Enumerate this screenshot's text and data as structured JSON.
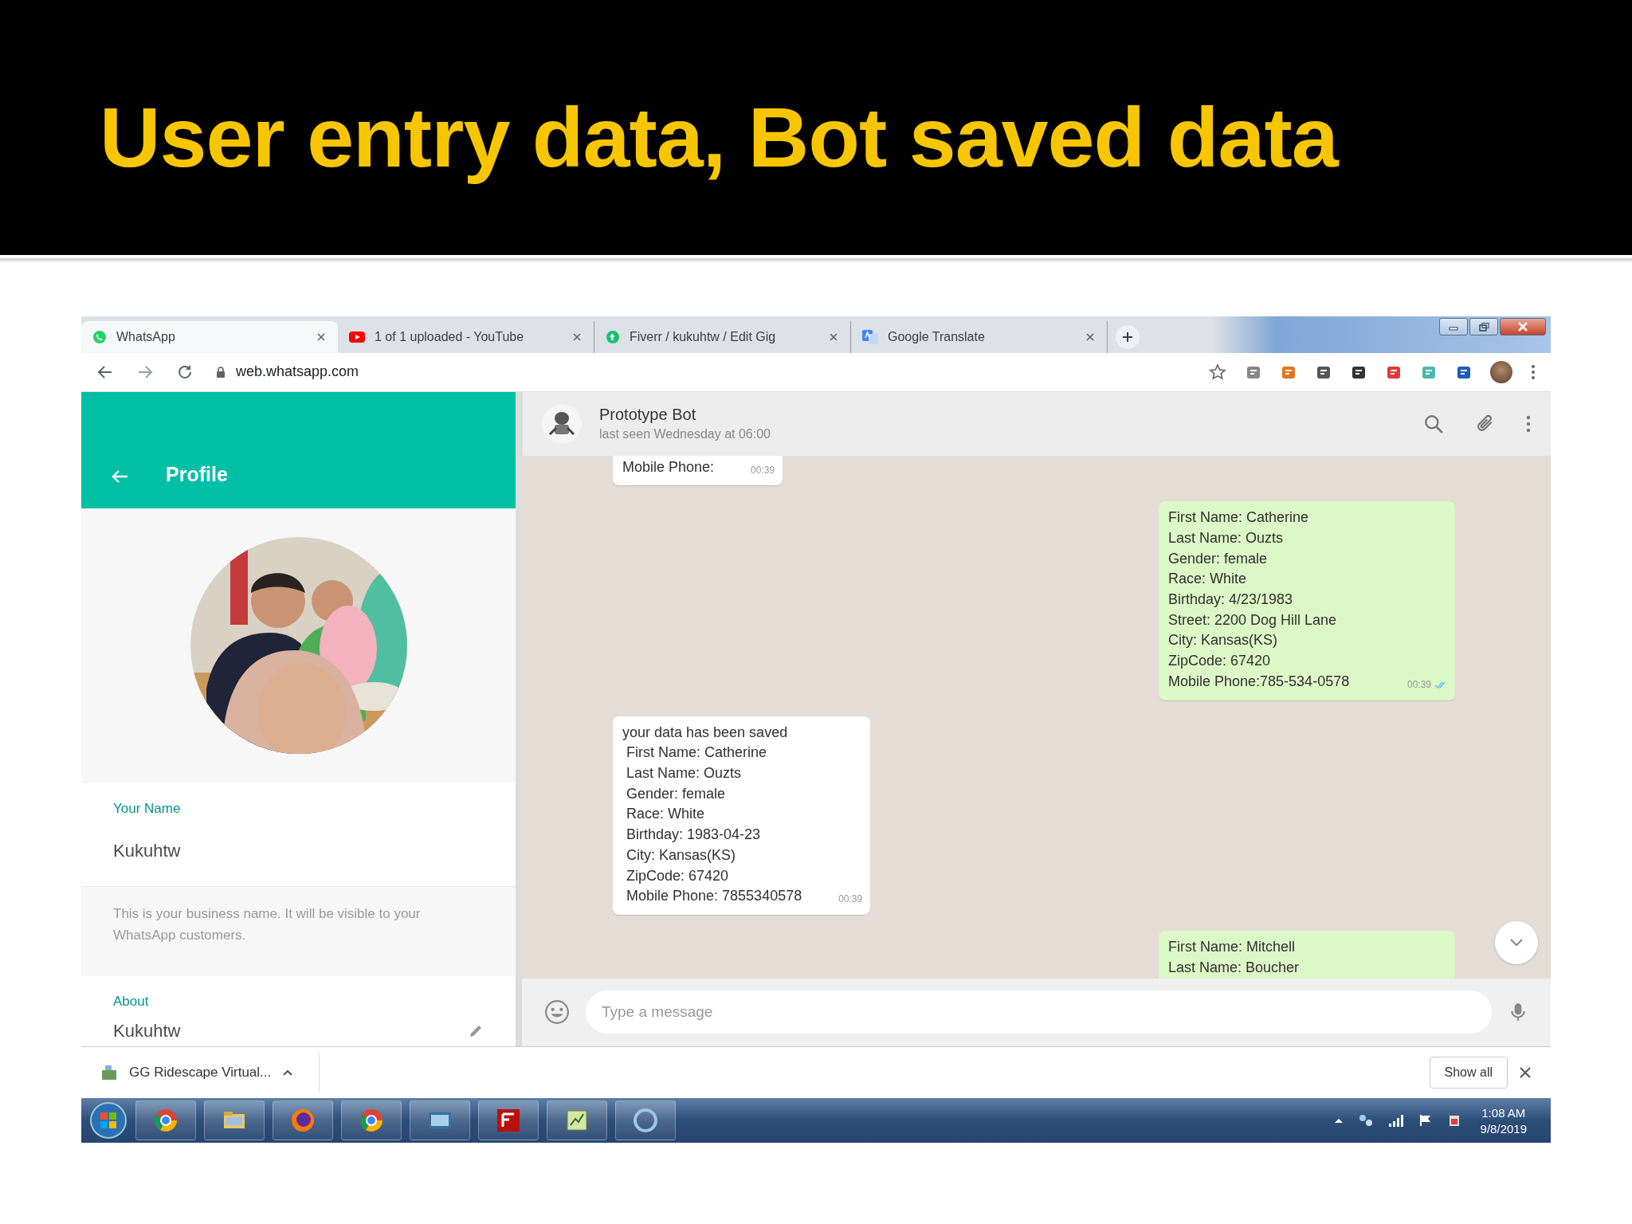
{
  "slide_title": "User entry data, Bot saved data",
  "browser": {
    "tabs": [
      {
        "title": "WhatsApp",
        "selected": true
      },
      {
        "title": "1 of 1 uploaded - YouTube",
        "selected": false
      },
      {
        "title": "Fiverr / kukuhtw / Edit Gig",
        "selected": false
      },
      {
        "title": "Google Translate",
        "selected": false
      }
    ],
    "address": "web.whatsapp.com"
  },
  "profile": {
    "title": "Profile",
    "name_label": "Your Name",
    "name": "Kukuhtw",
    "name_hint": "This is your business name. It will be visible to your WhatsApp customers.",
    "about_label": "About",
    "about": "Kukuhtw"
  },
  "chat": {
    "contact": "Prototype Bot",
    "status": "last seen Wednesday at 06:00",
    "messages": [
      {
        "kind": "in",
        "lines": [
          "Mobile Phone:"
        ],
        "time": "00:39"
      },
      {
        "kind": "out",
        "lines": [
          "First Name: Catherine",
          "Last Name: Ouzts",
          "Gender: female",
          "Race: White",
          "Birthday: 4/23/1983",
          "Street: 2200 Dog Hill Lane",
          "City: Kansas(KS)",
          "ZipCode: 67420",
          "Mobile Phone:785-534-0578"
        ],
        "time": "00:39",
        "read": true
      },
      {
        "kind": "in",
        "lines": [
          "your data has been saved",
          " First Name: Catherine",
          " Last Name: Ouzts",
          " Gender: female",
          " Race: White",
          " Birthday: 1983-04-23",
          " City: Kansas(KS)",
          " ZipCode: 67420",
          " Mobile Phone: 7855340578"
        ],
        "time": "00:39"
      },
      {
        "kind": "out",
        "lines": [
          "First Name: Mitchell",
          "Last Name: Boucher"
        ]
      }
    ],
    "input": {
      "placeholder": "Type a message"
    }
  },
  "downloads": {
    "file": "GG Ridescape Virtual...",
    "button": "Show all"
  },
  "taskbar": {
    "time": "1:08 AM",
    "date": "9/8/2019"
  }
}
